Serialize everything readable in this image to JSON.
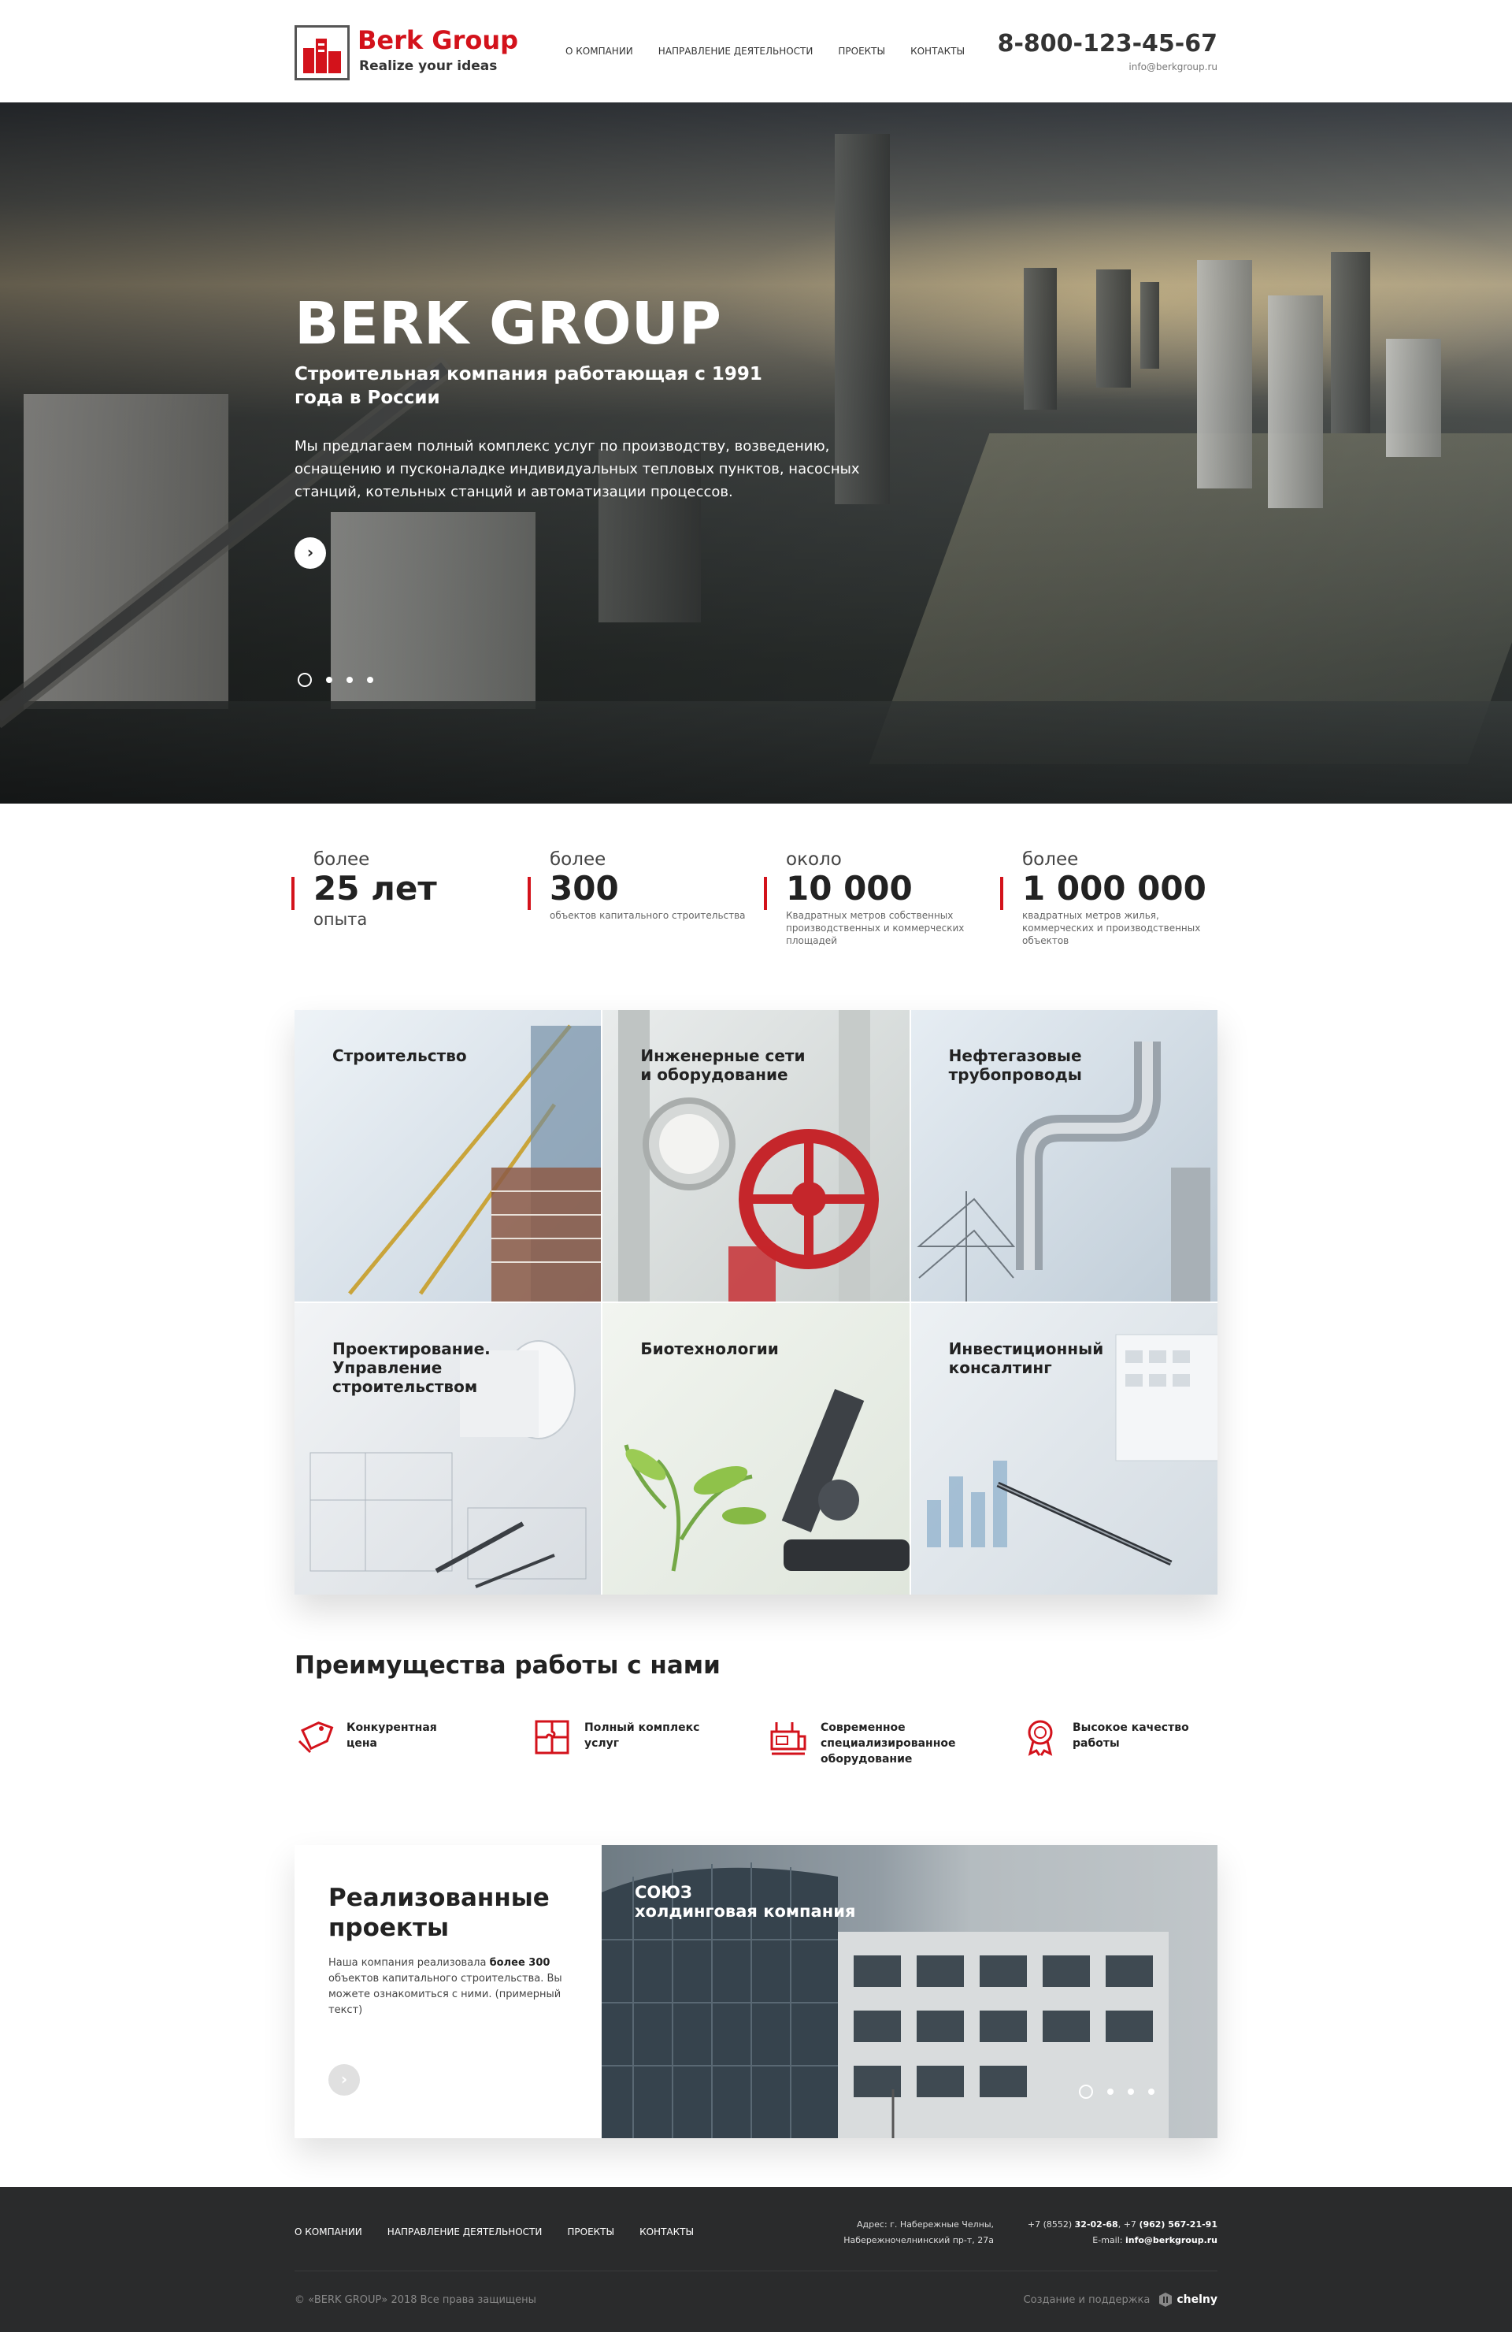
{
  "header": {
    "logo_name": "Berk Group",
    "logo_tagline": "Realize your ideas",
    "nav": [
      "О КОМПАНИИ",
      "НАПРАВЛЕНИЕ ДЕЯТЕЛЬНОСТИ",
      "ПРОЕКТЫ",
      "КОНТАКТЫ"
    ],
    "phone": "8-800-123-45-67",
    "email": "info@berkgroup.ru"
  },
  "hero": {
    "title": "BERK GROUP",
    "subtitle": "Строительная компания работающая с 1991 года в России",
    "description": "Мы предлагаем полный комплекс услуг по производству, возведению, оснащению и пусконаладке индивидуальных тепловых пунктов, насосных станций, котельных станций и автоматизации процессов.",
    "next_icon": "chevron-right-icon",
    "slide_count": 4,
    "active_slide": 1
  },
  "stats": [
    {
      "prefix": "более",
      "value": "25 лет",
      "caption": "опыта"
    },
    {
      "prefix": "более",
      "value": "300",
      "caption": "объектов капитального строительства"
    },
    {
      "prefix": "около",
      "value": "10 000",
      "caption": "Квадратных метров собственных производственных и коммерческих площадей"
    },
    {
      "prefix": "более",
      "value": "1 000 000",
      "caption": "квадратных метров жилья, коммерческих и производственных объектов"
    }
  ],
  "services": [
    {
      "label": "Строительство"
    },
    {
      "label": "Инженерные сети\nи оборудование"
    },
    {
      "label": "Нефтегазовые\nтрубопроводы"
    },
    {
      "label": "Проектирование.\nУправление\nстроительством"
    },
    {
      "label": "Биотехнологии"
    },
    {
      "label": "Инвестиционный\nконсалтинг"
    }
  ],
  "advantages": {
    "title": "Преимущества работы с нами",
    "items": [
      {
        "icon": "price-tag-icon",
        "label": "Конкурентная\nцена"
      },
      {
        "icon": "puzzle-icon",
        "label": "Полный комплекс\nуслуг"
      },
      {
        "icon": "equipment-icon",
        "label": "Современное\nспециализированное\nоборудование"
      },
      {
        "icon": "quality-badge-icon",
        "label": "Высокое качество\nработы"
      }
    ]
  },
  "projects": {
    "title": "Реализованные проекты",
    "text_before": "Наша компания реализовала ",
    "text_bold": "более 300",
    "text_after": " объектов капитального строительства. Вы можете ознакомиться с ними. (примерный текст)",
    "slide_caption": "СОЮЗ\nхолдинговая компания",
    "slide_count": 4,
    "active_slide": 1
  },
  "footer": {
    "nav": [
      "О КОМПАНИИ",
      "НАПРАВЛЕНИЕ ДЕЯТЕЛЬНОСТИ",
      "ПРОЕКТЫ",
      "КОНТАКТЫ"
    ],
    "address": "Адрес: г. Набережные Челны,\nНабережночелнинский пр-т, 27а",
    "phone_prefix_1": "+7 (8552) ",
    "phone_1": "32-02-68",
    "phone_sep": ", +7 ",
    "phone_2": "(962) 567-21-91",
    "email_label": "E-mail: ",
    "email": "info@berkgroup.ru",
    "copyright": "©  «BERK GROUP» 2018   Все права защищены",
    "made_by": "Создание и поддержка",
    "made_by_brand": "chelny"
  },
  "colors": {
    "accent": "#d3121b",
    "footer_bg": "#2a2b2c"
  }
}
